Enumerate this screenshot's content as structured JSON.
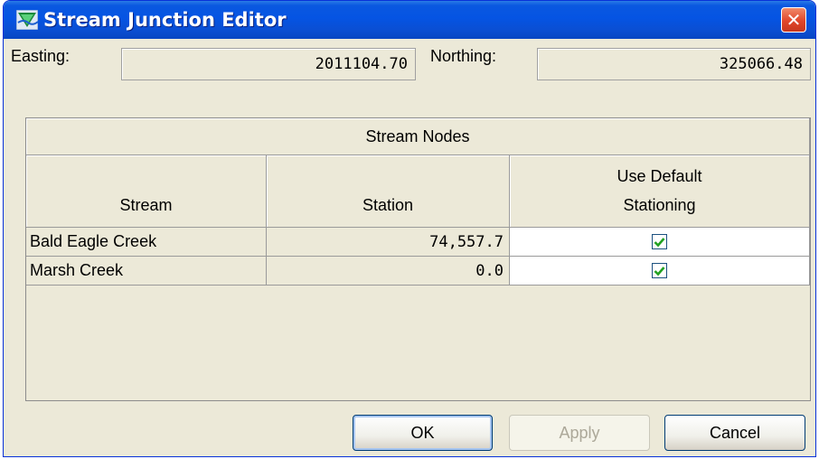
{
  "window": {
    "title": "Stream Junction Editor",
    "close_symbol": "✕",
    "title_icon": "app-icon"
  },
  "coords": {
    "easting_label": "Easting:",
    "easting_value": "2011104.70",
    "northing_label": "Northing:",
    "northing_value": "325066.48"
  },
  "table": {
    "group_header": "Stream Nodes",
    "columns": [
      "Stream",
      "Station",
      "Use Default",
      "Stationing"
    ],
    "rows": [
      {
        "stream": "Bald Eagle Creek",
        "station": "74,557.7",
        "use_default": true
      },
      {
        "stream": "Marsh Creek",
        "station": "0.0",
        "use_default": true
      }
    ]
  },
  "buttons": {
    "ok": "OK",
    "apply": "Apply",
    "cancel": "Cancel"
  },
  "colors": {
    "titlebar": "#0554e3",
    "panel": "#ece9d8",
    "check": "#21a121"
  }
}
